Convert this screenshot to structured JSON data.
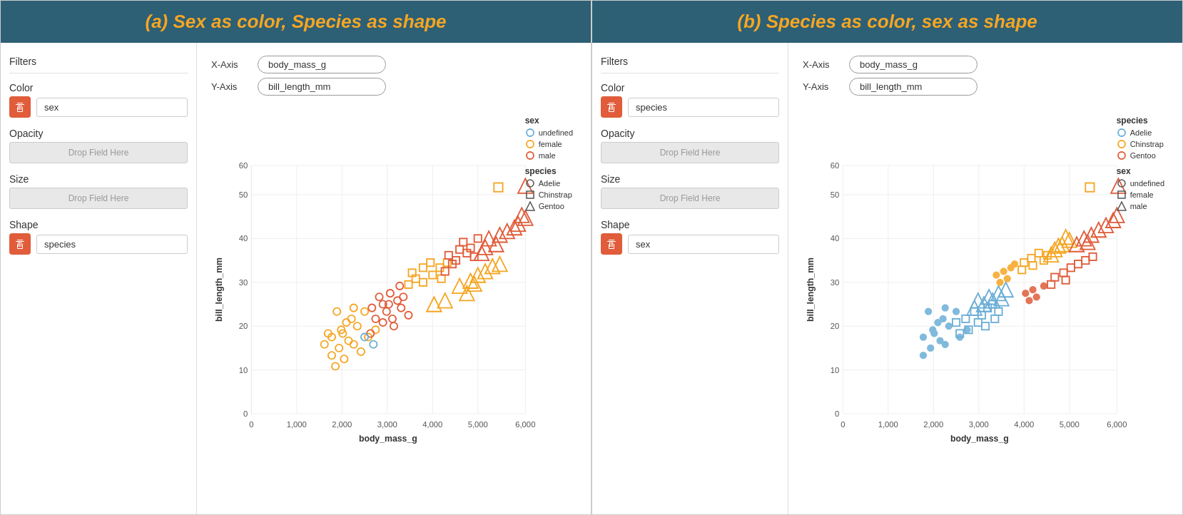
{
  "panel_a": {
    "title": "(a) Sex as color, Species as shape",
    "filters_label": "Filters",
    "xaxis_label": "X-Axis",
    "yaxis_label": "Y-Axis",
    "xaxis_value": "body_mass_g",
    "yaxis_value": "bill_length_mm",
    "color_label": "Color",
    "color_field": "sex",
    "opacity_label": "Opacity",
    "opacity_placeholder": "Drop Field Here",
    "size_label": "Size",
    "size_placeholder": "Drop Field Here",
    "shape_label": "Shape",
    "shape_field": "species",
    "legend": {
      "color_title": "sex",
      "color_items": [
        {
          "label": "undefined",
          "shape": "circle",
          "color": "#6baed6"
        },
        {
          "label": "female",
          "shape": "circle",
          "color": "#f5a623"
        },
        {
          "label": "male",
          "shape": "circle",
          "color": "#e05c3a"
        }
      ],
      "shape_title": "species",
      "shape_items": [
        {
          "label": "Adelie",
          "shape": "circle"
        },
        {
          "label": "Chinstrap",
          "shape": "square"
        },
        {
          "label": "Gentoo",
          "shape": "triangle"
        }
      ]
    }
  },
  "panel_b": {
    "title": "(b) Species as color, sex as shape",
    "filters_label": "Filters",
    "xaxis_label": "X-Axis",
    "yaxis_label": "Y-Axis",
    "xaxis_value": "body_mass_g",
    "yaxis_value": "bill_length_mm",
    "color_label": "Color",
    "color_field": "species",
    "opacity_label": "Opacity",
    "opacity_placeholder": "Drop Field Here",
    "size_label": "Size",
    "size_placeholder": "Drop Field Here",
    "shape_label": "Shape",
    "shape_field": "sex",
    "legend": {
      "color_title": "species",
      "color_items": [
        {
          "label": "Adelie",
          "shape": "circle",
          "color": "#6baed6"
        },
        {
          "label": "Chinstrap",
          "shape": "circle",
          "color": "#f5a623"
        },
        {
          "label": "Gentoo",
          "shape": "circle",
          "color": "#e05c3a"
        }
      ],
      "shape_title": "sex",
      "shape_items": [
        {
          "label": "undefined",
          "shape": "circle"
        },
        {
          "label": "female",
          "shape": "square"
        },
        {
          "label": "male",
          "shape": "triangle"
        }
      ]
    }
  },
  "colors": {
    "header_bg": "#2d5f75",
    "header_text": "#f5a623",
    "delete_btn": "#e05c3a",
    "undefined_color": "#6baed6",
    "female_color": "#f5a623",
    "male_color": "#e05c3a",
    "adelie_color": "#6baed6",
    "chinstrap_color": "#f5a623",
    "gentoo_color": "#e05c3a"
  }
}
